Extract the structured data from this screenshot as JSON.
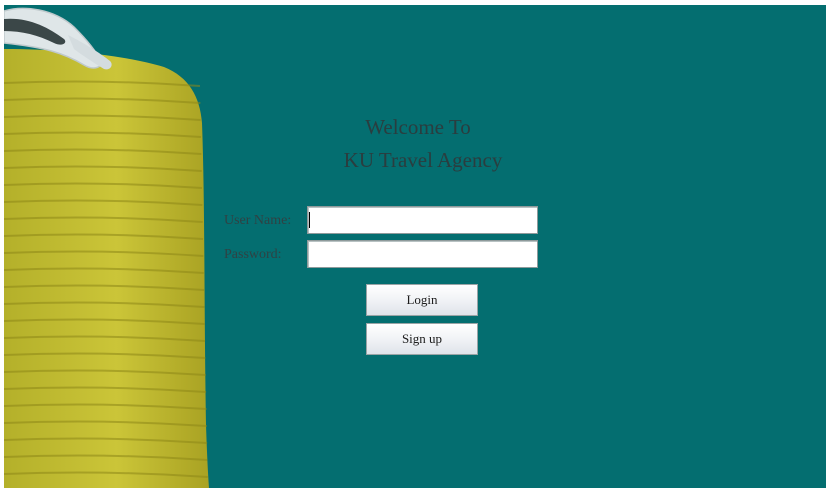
{
  "welcome": {
    "line1": "Welcome To",
    "line2": "KU Travel Agency"
  },
  "form": {
    "username_label": "User Name:",
    "username_value": "",
    "password_label": "Password:",
    "password_value": ""
  },
  "buttons": {
    "login_label": "Login",
    "signup_label": "Sign up"
  },
  "colors": {
    "background": "#046e70",
    "suitcase": "#c8c232",
    "title_text": "#2a3d3f"
  },
  "icons": {
    "decoration": "suitcase-with-sunglasses-icon"
  }
}
